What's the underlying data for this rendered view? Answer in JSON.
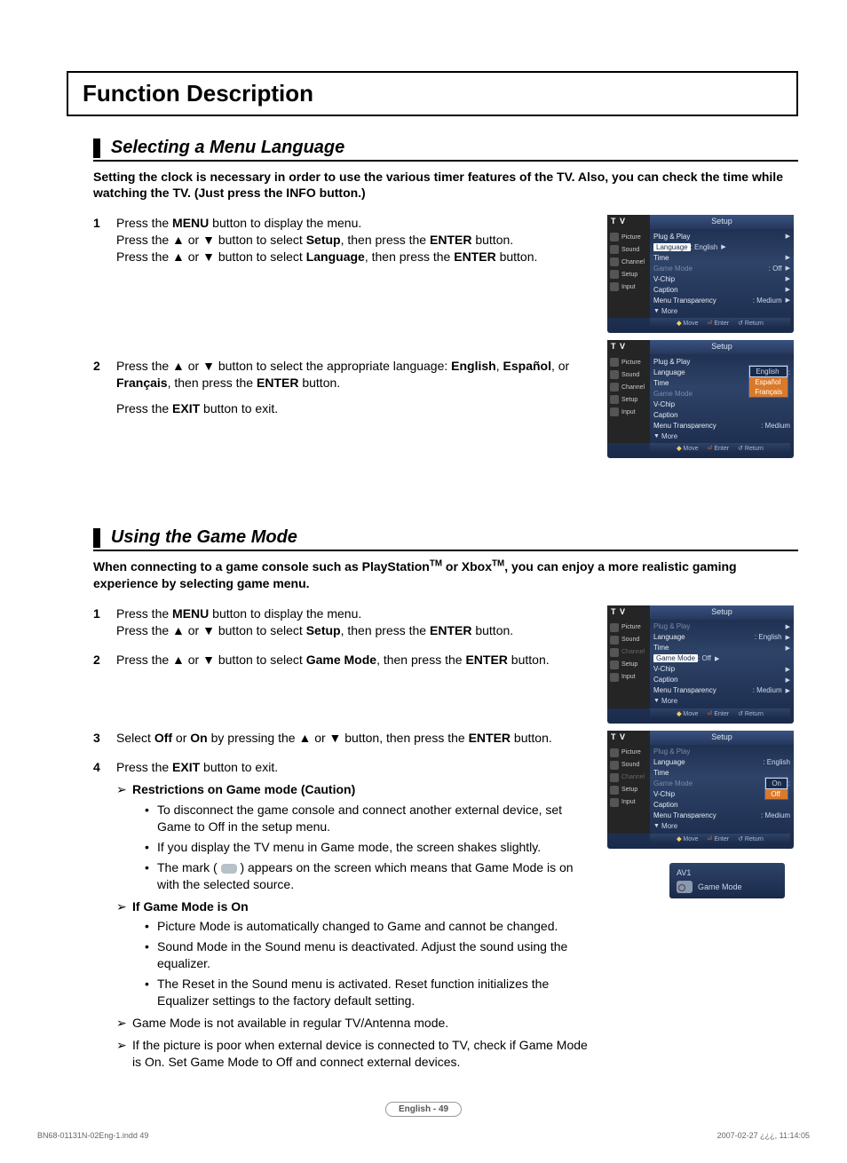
{
  "title": "Function Description",
  "sec1": {
    "heading": "Selecting a Menu Language",
    "intro": "Setting the clock is necessary in order to use the various timer features of the TV. Also, you can check the time while watching the TV. (Just press the INFO button.)",
    "step1_a": "Press the ",
    "step1_menu": "MENU",
    "step1_b": " button to display the menu.",
    "step1_c": "Press the ▲ or ▼ button to select ",
    "step1_setup": "Setup",
    "step1_d": ", then press the ",
    "step1_enter": "ENTER",
    "step1_e": " button.",
    "step1_f": "Press the ▲ or ▼ button to select ",
    "step1_lang": "Language",
    "step1_g": ", then press the ",
    "step1_enter2": "ENTER",
    "step1_h": " button.",
    "step2_a": "Press the ▲ or ▼ button to select the appropriate language: ",
    "step2_en": "English",
    "step2_comma": ", ",
    "step2_es": "Español",
    "step2_or": ", or ",
    "step2_fr": "Français",
    "step2_b": ", then press the ",
    "step2_enter": "ENTER",
    "step2_c": " button.",
    "step2_exit_a": "Press the ",
    "step2_exit": "EXIT",
    "step2_exit_b": " button to exit."
  },
  "sec2": {
    "heading": "Using the Game Mode",
    "intro_a": "When connecting to a game console such as PlayStation",
    "intro_tm": "TM",
    "intro_b": " or Xbox",
    "intro_c": ", you can enjoy a more realistic gaming experience by selecting game menu.",
    "s1_a": "Press the ",
    "s1_menu": "MENU",
    "s1_b": " button to display the menu.",
    "s1_c": "Press the ▲ or ▼ button to select ",
    "s1_setup": "Setup",
    "s1_d": ", then press the ",
    "s1_enter": "ENTER",
    "s1_e": " button.",
    "s2_a": "Press the ▲ or ▼ button to select ",
    "s2_gm": "Game Mode",
    "s2_b": ", then press the ",
    "s2_enter": "ENTER",
    "s2_c": " button.",
    "s3_a": "Select ",
    "s3_off": "Off",
    "s3_or": " or ",
    "s3_on": "On",
    "s3_b": " by pressing the ▲ or ▼ button, then press the ",
    "s3_enter": "ENTER",
    "s3_c": " button.",
    "s4_a": "Press the ",
    "s4_exit": "EXIT",
    "s4_b": " button to exit.",
    "restrict_h": "Restrictions on Game mode (Caution)",
    "restrict_1": "To disconnect the game console and connect another external device, set Game to Off in the setup menu.",
    "restrict_2": "If you display the TV menu in Game mode, the screen shakes slightly.",
    "restrict_3a": "The mark (",
    "restrict_3b": ") appears on the screen which means that Game Mode is on with the selected source.",
    "on_h": "If Game Mode is On",
    "on_1": "Picture Mode is automatically changed to Game and cannot be changed.",
    "on_2": "Sound Mode in the Sound menu is deactivated. Adjust the sound using the equalizer.",
    "on_3": "The Reset in the Sound menu is activated. Reset function initializes the Equalizer settings to the factory default setting.",
    "note_1": "Game Mode is not available in regular TV/Antenna mode.",
    "note_2": "If the picture is poor when external device is connected to TV, check if Game Mode is On. Set Game Mode to Off and connect external devices."
  },
  "osd": {
    "tv": "T V",
    "setup": "Setup",
    "side_picture": "Picture",
    "side_sound": "Sound",
    "side_channel": "Channel",
    "side_setup": "Setup",
    "side_input": "Input",
    "plug": "Plug & Play",
    "language": "Language",
    "english": "English",
    "espanol": "Español",
    "francais": "Français",
    "time": "Time",
    "game_mode": "Game Mode",
    "off": "Off",
    "on": "On",
    "vchip": "V-Chip",
    "caption": "Caption",
    "menu_trans": "Menu Transparency",
    "medium": "Medium",
    "more": "More",
    "move": "Move",
    "enter": "Enter",
    "return": "Return",
    "av1": "AV1",
    "gm_badge": "Game Mode"
  },
  "page_label": "English - 49",
  "footer_left": "BN68-01131N-02Eng-1.indd   49",
  "footer_right": "2007-02-27   ¿¿¿, 11:14:05"
}
